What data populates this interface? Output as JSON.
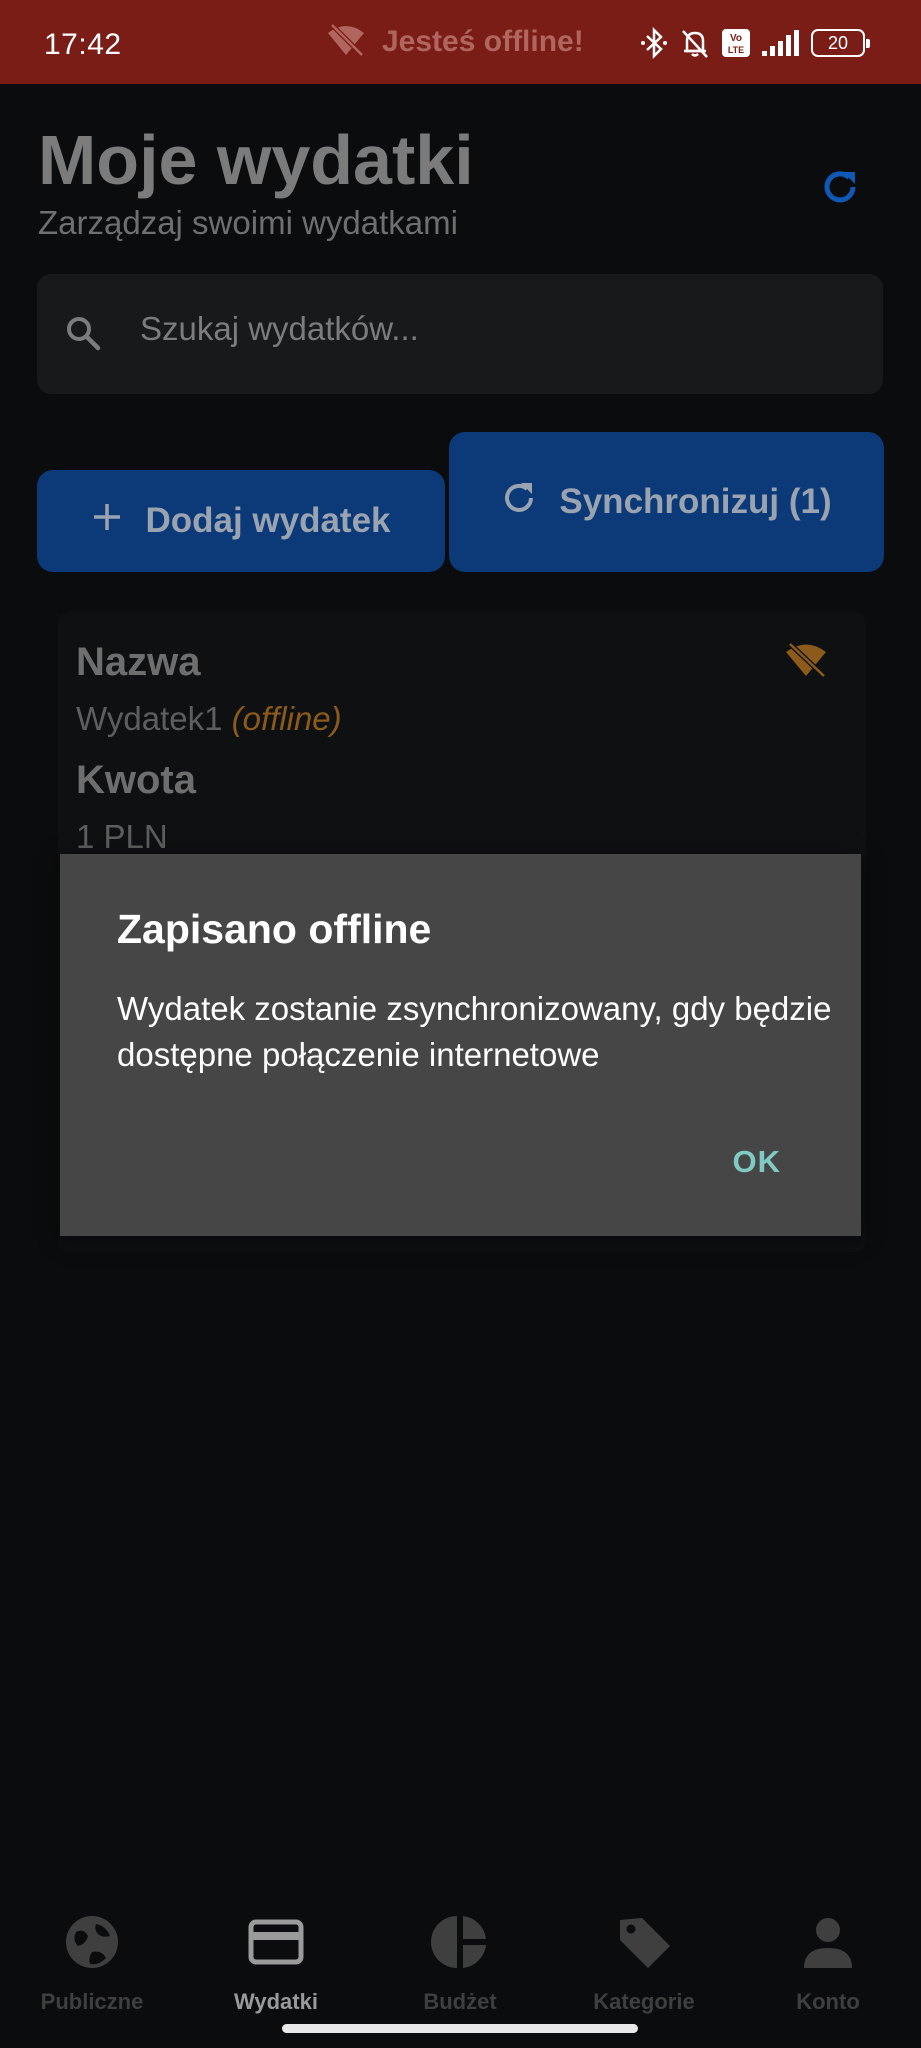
{
  "status_bar": {
    "time": "17:42",
    "offline_banner": "Jesteś offline!",
    "battery": "20",
    "icons": [
      "wifi-off-icon",
      "bluetooth-icon",
      "bell-off-icon",
      "volte-icon",
      "signal-icon",
      "battery-icon"
    ]
  },
  "header": {
    "title": "Moje wydatki",
    "subtitle": "Zarządzaj swoimi wydatkami",
    "refresh_icon": "refresh-icon"
  },
  "search": {
    "placeholder": "Szukaj wydatków...",
    "value": ""
  },
  "actions": {
    "add_label": "Dodaj wydatek",
    "sync_label": "Synchronizuj (1)"
  },
  "expense": {
    "name_label": "Nazwa",
    "name_value": "Wydatek1",
    "offline_tag": "(offline)",
    "amount_label": "Kwota",
    "amount_value": "1 PLN"
  },
  "dialog": {
    "title": "Zapisano offline",
    "message": "Wydatek zostanie zsynchronizowany, gdy będzie dostępne połączenie internetowe",
    "ok_label": "OK"
  },
  "bottom_nav": {
    "items": [
      {
        "label": "Publiczne",
        "icon": "globe-icon",
        "active": false
      },
      {
        "label": "Wydatki",
        "icon": "card-icon",
        "active": true
      },
      {
        "label": "Budżet",
        "icon": "pie-chart-icon",
        "active": false
      },
      {
        "label": "Kategorie",
        "icon": "tag-icon",
        "active": false
      },
      {
        "label": "Konto",
        "icon": "person-icon",
        "active": false
      }
    ]
  },
  "colors": {
    "status_bar": "#7a1d16",
    "background": "#0b0c0e",
    "primary_button": "#0c3a78",
    "refresh_accent": "#0f58b5",
    "offline_accent": "#8c5a1a",
    "dialog_background": "#464646",
    "dialog_action": "#7fcbc4"
  }
}
